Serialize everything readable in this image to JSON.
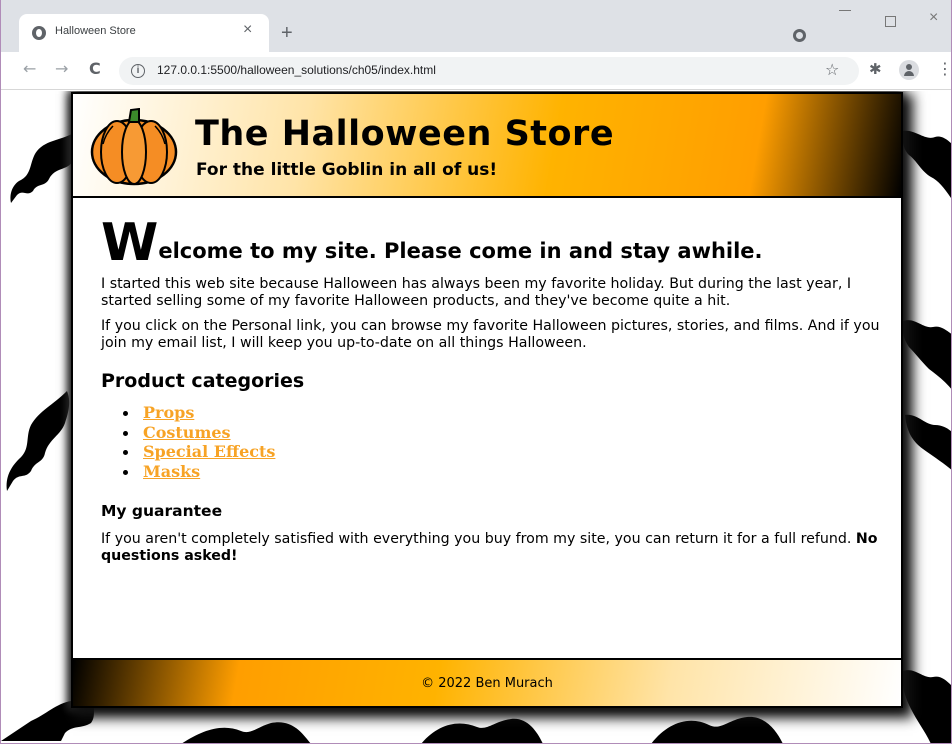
{
  "browser": {
    "tab_title": "Halloween Store",
    "tab_close": "×",
    "new_tab": "+",
    "url": "127.0.0.1:5500/halloween_solutions/ch05/index.html",
    "info_glyph": "i",
    "back_glyph": "←",
    "forward_glyph": "→",
    "reload_glyph": "C",
    "star_glyph": "☆",
    "extension_glyph": "✱",
    "menu_glyph": "⋮",
    "close_glyph": "×"
  },
  "header": {
    "title": "The Halloween Store",
    "tagline": "For the little Goblin in all of us!"
  },
  "main": {
    "welcome_dropcap": "W",
    "welcome_rest": "elcome to my site. Please come in and stay awhile.",
    "intro_1": "I started this web site because Halloween has always been my favorite holiday. But during the last year, I started selling some of my favorite Halloween products, and they've become quite a hit.",
    "intro_2": "If you click on the Personal link, you can browse my favorite Halloween pictures, stories, and films. And if you join my email list, I will keep you up-to-date on all things Halloween.",
    "categories_heading": "Product categories",
    "categories": [
      "Props",
      "Costumes",
      "Special Effects",
      "Masks"
    ],
    "guarantee_heading": "My guarantee",
    "guarantee_text": "If you aren't completely satisfied with everything you buy from my site, you can return it for a full refund. ",
    "guarantee_bold": "No questions asked!"
  },
  "footer": {
    "copyright": "© 2022 Ben Murach"
  },
  "colors": {
    "link": "#f7a325",
    "header_orange": "#ffb300",
    "pumpkin": "#f58d24",
    "browser_chrome": "#dee1e6"
  },
  "icons": [
    "globe-favicon",
    "close-icon",
    "plus-icon",
    "search-tabs-icon",
    "back-arrow-icon",
    "forward-arrow-icon",
    "reload-icon",
    "info-icon",
    "star-icon",
    "puzzle-icon",
    "profile-icon",
    "kebab-menu-icon",
    "pumpkin-logo",
    "bat-icon"
  ]
}
